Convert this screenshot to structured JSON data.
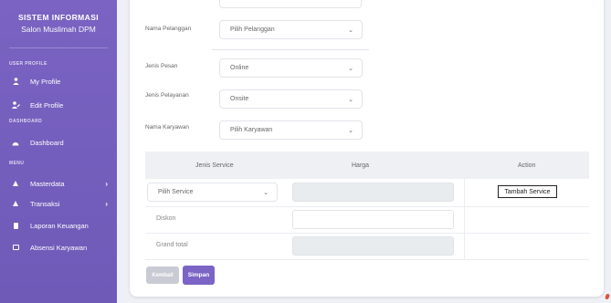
{
  "sidebar": {
    "brand_title": "SISTEM INFORMASI",
    "brand_subtitle": "Salon Muslimah DPM",
    "sections": {
      "user_profile": "USER PROFILE",
      "dashboard": "DASHBOARD",
      "menu": "MENU"
    },
    "items": [
      {
        "label": "My Profile",
        "icon": "user-icon"
      },
      {
        "label": "Edit Profile",
        "icon": "user-edit-icon"
      },
      {
        "label": "Dashboard",
        "icon": "dashboard-icon"
      },
      {
        "label": "Masterdata",
        "icon": "masterdata-icon",
        "chevron": "›"
      },
      {
        "label": "Transaksi",
        "icon": "transaksi-icon",
        "chevron": "›"
      },
      {
        "label": "Laporan Keuangan",
        "icon": "report-icon"
      },
      {
        "label": "Absensi Karyawan",
        "icon": "attendance-icon"
      }
    ]
  },
  "form": {
    "nama_pelanggan": {
      "label": "Nama Pelanggan",
      "value": "Pilih Pelanggan"
    },
    "jenis_pesan": {
      "label": "Jenis Pesan",
      "value": "Online"
    },
    "jenis_pelayanan": {
      "label": "Jenis Pelayanan",
      "value": "Onsite"
    },
    "nama_karyawan": {
      "label": "Nama Karyawan",
      "value": "Pilih Karyawan"
    },
    "chevron": "⌄"
  },
  "table": {
    "headers": {
      "service": "Jenis Service",
      "harga": "Harga",
      "action": "Action"
    },
    "service_select": "Pilih Service",
    "add_button": "Tambah Service",
    "diskon_label": "Diskon",
    "grand_total_label": "Grand total"
  },
  "buttons": {
    "back": "Kembali",
    "save": "Simpan"
  },
  "colors": {
    "sidebar": "#7a63c2",
    "primary": "#7b64c5",
    "disabled": "#c9cbd4"
  }
}
